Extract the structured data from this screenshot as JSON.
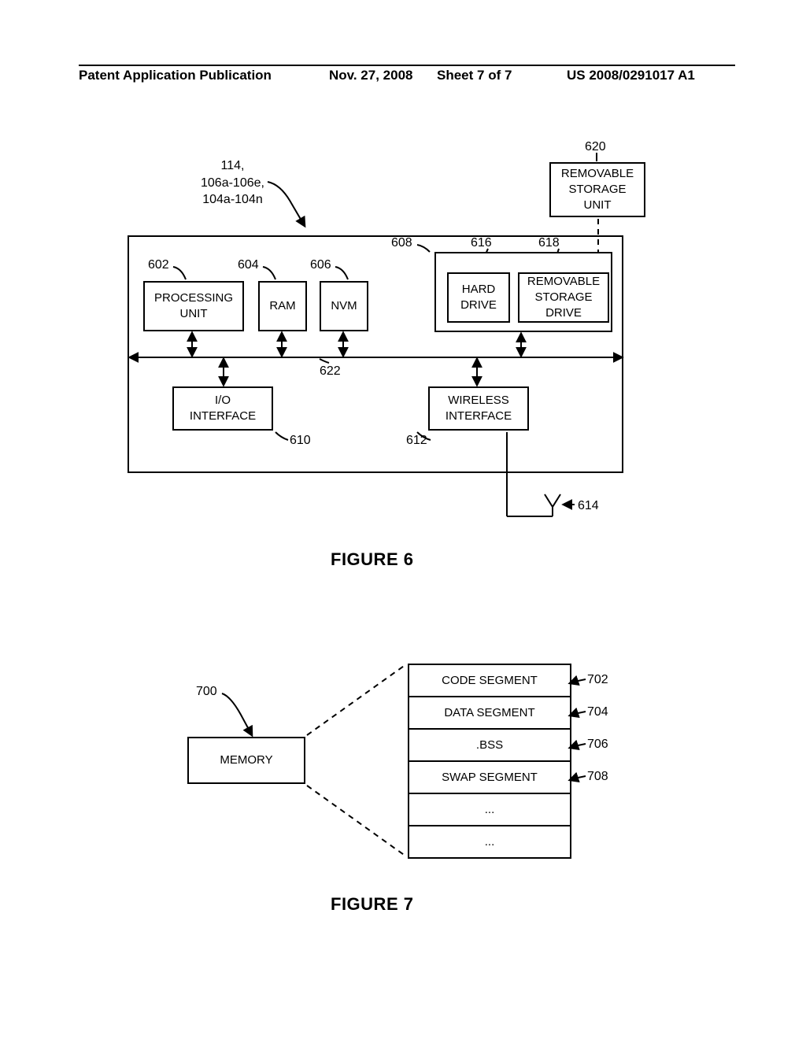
{
  "header": {
    "pub": "Patent Application Publication",
    "date": "Nov. 27, 2008",
    "sheet": "Sheet 7 of 7",
    "pubno": "US 2008/0291017 A1"
  },
  "fig6": {
    "caption": "FIGURE 6",
    "system_ref_l1": "114,",
    "system_ref_l2": "106a-106e,",
    "system_ref_l3": "104a-104n",
    "refs": {
      "602": "602",
      "604": "604",
      "606": "606",
      "608": "608",
      "610": "610",
      "612": "612",
      "614": "614",
      "616": "616",
      "618": "618",
      "620": "620",
      "622": "622"
    },
    "blocks": {
      "processing": "PROCESSING\nUNIT",
      "ram": "RAM",
      "nvm": "NVM",
      "hard_drive": "HARD\nDRIVE",
      "rsd": "REMOVABLE\nSTORAGE\nDRIVE",
      "rsu": "REMOVABLE\nSTORAGE\nUNIT",
      "io": "I/O\nINTERFACE",
      "wireless": "WIRELESS\nINTERFACE"
    }
  },
  "fig7": {
    "caption": "FIGURE 7",
    "refs": {
      "700": "700",
      "702": "702",
      "704": "704",
      "706": "706",
      "708": "708"
    },
    "memory": "MEMORY",
    "rows": {
      "code": "CODE SEGMENT",
      "data": "DATA SEGMENT",
      "bss": ".BSS",
      "swap": "SWAP SEGMENT",
      "e1": "...",
      "e2": "..."
    }
  }
}
